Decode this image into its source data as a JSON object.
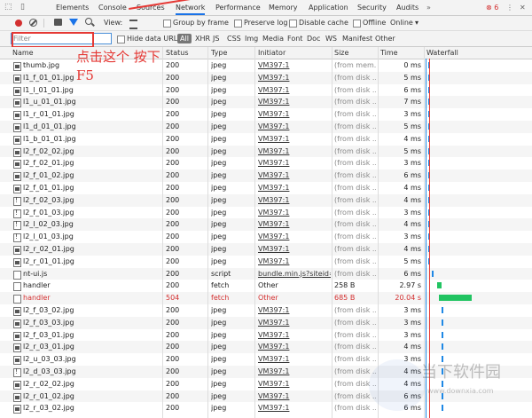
{
  "tabs": {
    "items": [
      "Elements",
      "Console",
      "Sources",
      "Network",
      "Performance",
      "Memory",
      "Application",
      "Security",
      "Audits"
    ],
    "more": "»",
    "error_count": "6"
  },
  "toolbar": {
    "view_label": "View:",
    "group_by_frame": "Group by frame",
    "preserve_log": "Preserve log",
    "disable_cache": "Disable cache",
    "offline": "Offline",
    "online": "Online"
  },
  "filter": {
    "placeholder": "Filter",
    "hide_data_urls": "Hide data URLs",
    "types": [
      "All",
      "XHR",
      "JS",
      "CSS",
      "Img",
      "Media",
      "Font",
      "Doc",
      "WS",
      "Manifest",
      "Other"
    ]
  },
  "columns": [
    "Name",
    "Status",
    "Type",
    "Initiator",
    "Size",
    "Time",
    "Waterfall"
  ],
  "rows": [
    {
      "name": "thumb.jpg",
      "status": "200",
      "type": "jpeg",
      "initiator": "VM397:1",
      "size": "(from mem...",
      "time": "0 ms",
      "icon": "img"
    },
    {
      "name": "l1_f_01_01.jpg",
      "status": "200",
      "type": "jpeg",
      "initiator": "VM397:1",
      "size": "(from disk ...",
      "time": "5 ms",
      "icon": "img"
    },
    {
      "name": "l1_l_01_01.jpg",
      "status": "200",
      "type": "jpeg",
      "initiator": "VM397:1",
      "size": "(from disk ...",
      "time": "6 ms",
      "icon": "img"
    },
    {
      "name": "l1_u_01_01.jpg",
      "status": "200",
      "type": "jpeg",
      "initiator": "VM397:1",
      "size": "(from disk ...",
      "time": "7 ms",
      "icon": "img"
    },
    {
      "name": "l1_r_01_01.jpg",
      "status": "200",
      "type": "jpeg",
      "initiator": "VM397:1",
      "size": "(from disk ...",
      "time": "3 ms",
      "icon": "img"
    },
    {
      "name": "l1_d_01_01.jpg",
      "status": "200",
      "type": "jpeg",
      "initiator": "VM397:1",
      "size": "(from disk ...",
      "time": "5 ms",
      "icon": "img"
    },
    {
      "name": "l1_b_01_01.jpg",
      "status": "200",
      "type": "jpeg",
      "initiator": "VM397:1",
      "size": "(from disk ...",
      "time": "4 ms",
      "icon": "img"
    },
    {
      "name": "l2_f_02_02.jpg",
      "status": "200",
      "type": "jpeg",
      "initiator": "VM397:1",
      "size": "(from disk ...",
      "time": "5 ms",
      "icon": "img"
    },
    {
      "name": "l2_f_02_01.jpg",
      "status": "200",
      "type": "jpeg",
      "initiator": "VM397:1",
      "size": "(from disk ...",
      "time": "3 ms",
      "icon": "img"
    },
    {
      "name": "l2_f_01_02.jpg",
      "status": "200",
      "type": "jpeg",
      "initiator": "VM397:1",
      "size": "(from disk ...",
      "time": "6 ms",
      "icon": "img"
    },
    {
      "name": "l2_f_01_01.jpg",
      "status": "200",
      "type": "jpeg",
      "initiator": "VM397:1",
      "size": "(from disk ...",
      "time": "4 ms",
      "icon": "img"
    },
    {
      "name": "l2_f_02_03.jpg",
      "status": "200",
      "type": "jpeg",
      "initiator": "VM397:1",
      "size": "(from disk ...",
      "time": "4 ms",
      "icon": "warn"
    },
    {
      "name": "l2_f_01_03.jpg",
      "status": "200",
      "type": "jpeg",
      "initiator": "VM397:1",
      "size": "(from disk ...",
      "time": "3 ms",
      "icon": "warn"
    },
    {
      "name": "l2_l_02_03.jpg",
      "status": "200",
      "type": "jpeg",
      "initiator": "VM397:1",
      "size": "(from disk ...",
      "time": "4 ms",
      "icon": "warn"
    },
    {
      "name": "l2_l_01_03.jpg",
      "status": "200",
      "type": "jpeg",
      "initiator": "VM397:1",
      "size": "(from disk ...",
      "time": "3 ms",
      "icon": "warn"
    },
    {
      "name": "l2_r_02_01.jpg",
      "status": "200",
      "type": "jpeg",
      "initiator": "VM397:1",
      "size": "(from disk ...",
      "time": "4 ms",
      "icon": "img"
    },
    {
      "name": "l2_r_01_01.jpg",
      "status": "200",
      "type": "jpeg",
      "initiator": "VM397:1",
      "size": "(from disk ...",
      "time": "5 ms",
      "icon": "img"
    },
    {
      "name": "nt-ui.js",
      "status": "200",
      "type": "script",
      "initiator": "bundle.min.js?siteid=...",
      "size": "(from disk ...",
      "time": "6 ms",
      "icon": "plain"
    },
    {
      "name": "handler",
      "status": "200",
      "type": "fetch",
      "initiator": "Other",
      "size": "258 B",
      "time": "2.97 s",
      "icon": "plain"
    },
    {
      "name": "handler",
      "status": "504",
      "type": "fetch",
      "initiator": "Other",
      "size": "685 B",
      "time": "20.04 s",
      "icon": "plain",
      "error": true
    },
    {
      "name": "l2_f_03_02.jpg",
      "status": "200",
      "type": "jpeg",
      "initiator": "VM397:1",
      "size": "(from disk ...",
      "time": "3 ms",
      "icon": "img"
    },
    {
      "name": "l2_f_03_03.jpg",
      "status": "200",
      "type": "jpeg",
      "initiator": "VM397:1",
      "size": "(from disk ...",
      "time": "3 ms",
      "icon": "img"
    },
    {
      "name": "l2_f_03_01.jpg",
      "status": "200",
      "type": "jpeg",
      "initiator": "VM397:1",
      "size": "(from disk ...",
      "time": "3 ms",
      "icon": "img"
    },
    {
      "name": "l2_r_03_01.jpg",
      "status": "200",
      "type": "jpeg",
      "initiator": "VM397:1",
      "size": "(from disk ...",
      "time": "4 ms",
      "icon": "img"
    },
    {
      "name": "l2_u_03_03.jpg",
      "status": "200",
      "type": "jpeg",
      "initiator": "VM397:1",
      "size": "(from disk ...",
      "time": "3 ms",
      "icon": "img"
    },
    {
      "name": "l2_d_03_03.jpg",
      "status": "200",
      "type": "jpeg",
      "initiator": "VM397:1",
      "size": "(from disk ...",
      "time": "4 ms",
      "icon": "warn"
    },
    {
      "name": "l2_r_02_02.jpg",
      "status": "200",
      "type": "jpeg",
      "initiator": "VM397:1",
      "size": "(from disk ...",
      "time": "4 ms",
      "icon": "img"
    },
    {
      "name": "l2_r_01_02.jpg",
      "status": "200",
      "type": "jpeg",
      "initiator": "VM397:1",
      "size": "(from disk ...",
      "time": "6 ms",
      "icon": "img"
    },
    {
      "name": "l2_r_03_02.jpg",
      "status": "200",
      "type": "jpeg",
      "initiator": "VM397:1",
      "size": "(from disk ...",
      "time": "6 ms",
      "icon": "img"
    }
  ],
  "annotation": "点击这个 按下F5",
  "watermark": {
    "text": "当下软件园",
    "url": "www.downxia.com"
  },
  "colors": {
    "error": "#d32f2f",
    "accent": "#1a73e8",
    "annotation": "#e53935",
    "waterfall_blue": "#1e88e5",
    "waterfall_green": "#21c462"
  }
}
